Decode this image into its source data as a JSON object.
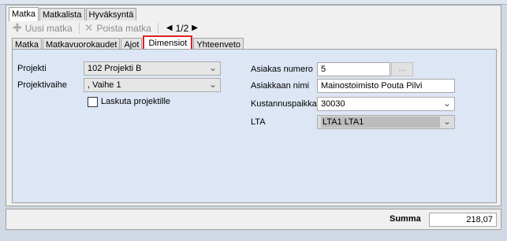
{
  "top_tabs": [
    {
      "label": "Matka"
    },
    {
      "label": "Matkalista"
    },
    {
      "label": "Hyväksyntä"
    }
  ],
  "toolbar": {
    "new_trip_label": "Uusi matka",
    "delete_trip_label": "Poista matka",
    "pager": "1/2"
  },
  "sub_tabs": [
    {
      "label": "Matka"
    },
    {
      "label": "Matkavuorokaudet"
    },
    {
      "label": "Ajot"
    },
    {
      "label": "Dimensiot"
    },
    {
      "label": "Yhteenveto"
    }
  ],
  "form": {
    "project_label": "Projekti",
    "project_value": "102 Projekti B",
    "phase_label": "Projektivaihe",
    "phase_value": ", Vaihe 1",
    "invoice_label": "Laskuta projektille",
    "customer_number_label": "Asiakas numero",
    "customer_number_value": "5",
    "ellipsis_label": "...",
    "customer_name_label": "Asiakkaan nimi",
    "customer_name_value": "Mainostoimisto Pouta Pilvi",
    "cost_center_label": "Kustannuspaikka",
    "cost_center_value": "30030",
    "lta_label": "LTA",
    "lta_value": "LTA1 LTA1"
  },
  "footer": {
    "sum_label": "Summa",
    "sum_value": "218,07"
  }
}
